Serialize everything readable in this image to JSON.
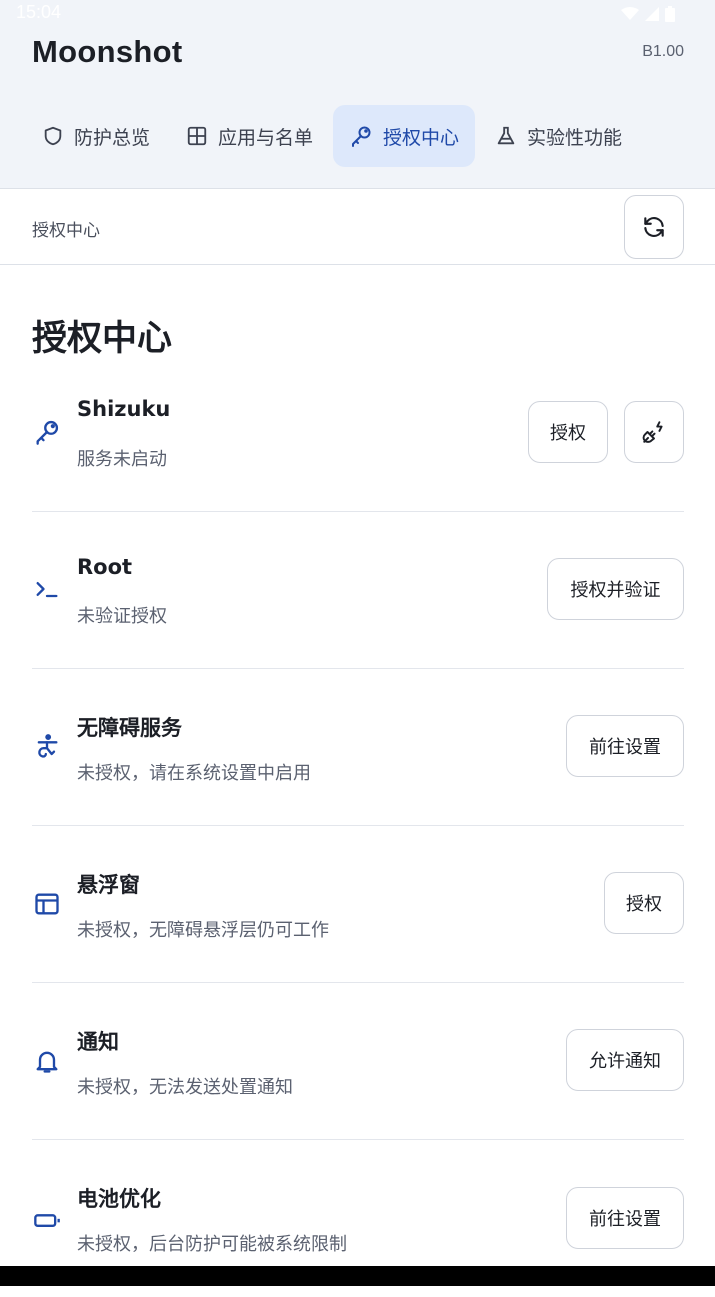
{
  "status_bar": {
    "time": "15:04"
  },
  "header": {
    "app_title": "Moonshot",
    "version": "B1.00",
    "tabs": [
      {
        "label": "防护总览",
        "icon": "shield-icon"
      },
      {
        "label": "应用与名单",
        "icon": "grid-icon"
      },
      {
        "label": "授权中心",
        "icon": "key-icon",
        "active": true
      },
      {
        "label": "实验性功能",
        "icon": "flask-icon"
      }
    ]
  },
  "breadcrumb": {
    "label": "授权中心",
    "refresh_icon": "refresh-icon"
  },
  "main": {
    "title": "授权中心",
    "items": [
      {
        "title": "Shizuku",
        "subtitle": "服务未启动",
        "icon": "key-icon",
        "button": "授权",
        "extra_icon": "plug-icon"
      },
      {
        "title": "Root",
        "subtitle": "未验证授权",
        "icon": "terminal-icon",
        "button": "授权并验证"
      },
      {
        "title": "无障碍服务",
        "subtitle": "未授权，请在系统设置中启用",
        "icon": "accessibility-icon",
        "button": "前往设置"
      },
      {
        "title": "悬浮窗",
        "subtitle": "未授权，无障碍悬浮层仍可工作",
        "icon": "window-icon",
        "button": "授权"
      },
      {
        "title": "通知",
        "subtitle": "未授权，无法发送处置通知",
        "icon": "bell-icon",
        "button": "允许通知"
      },
      {
        "title": "电池优化",
        "subtitle": "未授权，后台防护可能被系统限制",
        "icon": "battery-icon",
        "button": "前往设置"
      }
    ]
  },
  "colors": {
    "accent": "#1f49a8",
    "active_tab_bg": "#dde8fb",
    "header_bg": "#f1f4f9"
  }
}
